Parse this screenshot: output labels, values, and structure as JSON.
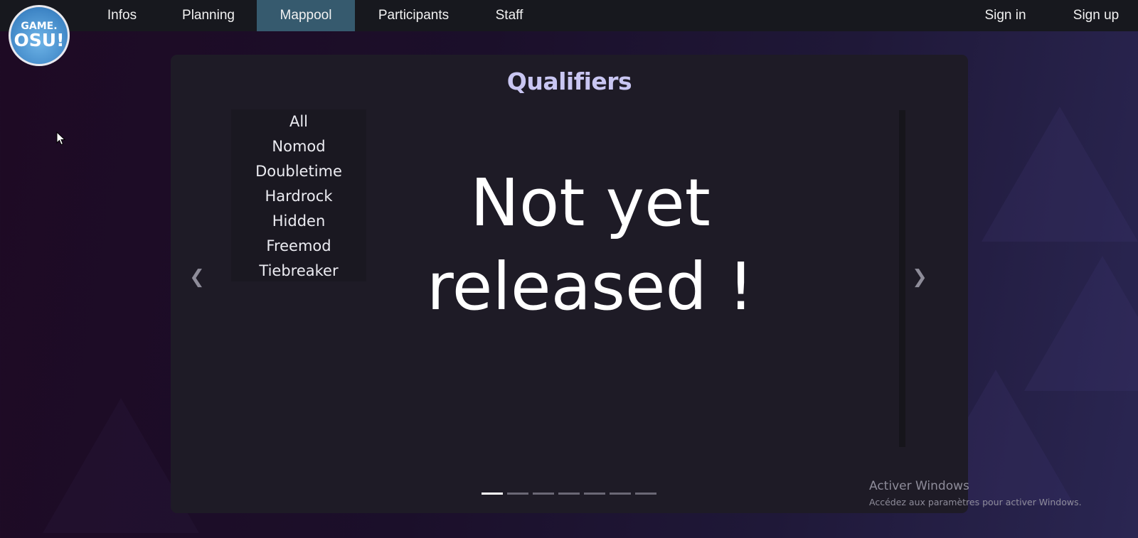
{
  "logo": {
    "line1": "GAME.",
    "line2": "OSU!"
  },
  "nav": {
    "items": [
      {
        "label": "Infos"
      },
      {
        "label": "Planning"
      },
      {
        "label": "Mappool"
      },
      {
        "label": "Participants"
      },
      {
        "label": "Staff"
      }
    ],
    "active": "Mappool",
    "auth": [
      {
        "label": "Sign in"
      },
      {
        "label": "Sign up"
      }
    ]
  },
  "card": {
    "title": "Qualifiers",
    "mods": [
      "All",
      "Nomod",
      "Doubletime",
      "Hardrock",
      "Hidden",
      "Freemod",
      "Tiebreaker"
    ],
    "status_line1": "Not yet",
    "status_line2": "released !",
    "prev_icon": "chevron-left-icon",
    "next_icon": "chevron-right-icon",
    "slide_count": 7,
    "active_slide": 1
  },
  "watermark": {
    "title": "Activer Windows",
    "subtitle": "Accédez aux paramètres pour activer Windows."
  },
  "colors": {
    "nav_bg": "#17181e",
    "nav_active": "#365a6e",
    "card_bg": "#1e1b26",
    "title": "#c9c6f2"
  }
}
